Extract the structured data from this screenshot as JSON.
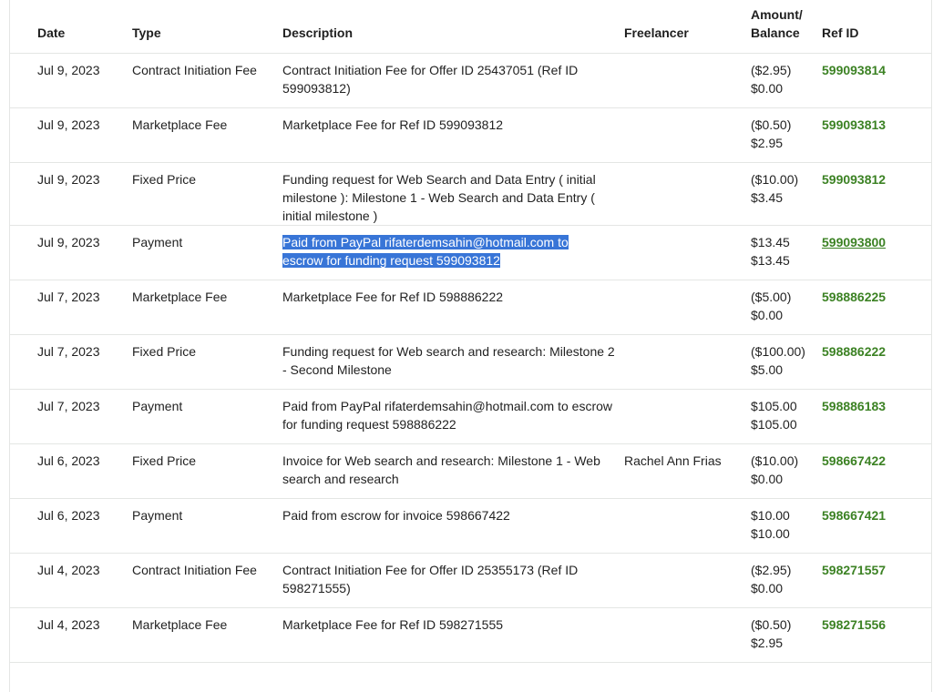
{
  "table": {
    "headers": {
      "date": "Date",
      "type": "Type",
      "description": "Description",
      "freelancer": "Freelancer",
      "amount_line1": "Amount/",
      "amount_line2": "Balance",
      "ref": "Ref ID"
    },
    "rows": [
      {
        "date": "Jul 9, 2023",
        "type": "Contract Initiation Fee",
        "description": "Contract Initiation Fee for Offer ID 25437051 (Ref ID 599093812)",
        "freelancer": "",
        "amount": "($2.95)",
        "balance": "$0.00",
        "ref": "599093814"
      },
      {
        "date": "Jul 9, 2023",
        "type": "Marketplace Fee",
        "description": "Marketplace Fee for Ref ID 599093812",
        "freelancer": "",
        "amount": "($0.50)",
        "balance": "$2.95",
        "ref": "599093813"
      },
      {
        "date": "Jul 9, 2023",
        "type": "Fixed Price",
        "description": "Funding request for Web Search and Data Entry ( initial milestone ): Milestone 1 - Web Search and Data Entry ( initial milestone )",
        "freelancer": "",
        "amount": "($10.00)",
        "balance": "$3.45",
        "ref": "599093812"
      },
      {
        "date": "Jul 9, 2023",
        "type": "Payment",
        "description_line1": "Paid from PayPal rifaterdemsahin@hotmail.com to",
        "description_line2": "escrow for funding request 599093812",
        "freelancer": "",
        "amount": "$13.45",
        "balance": "$13.45",
        "ref": "599093800"
      },
      {
        "date": "Jul 7, 2023",
        "type": "Marketplace Fee",
        "description": "Marketplace Fee for Ref ID 598886222",
        "freelancer": "",
        "amount": "($5.00)",
        "balance": "$0.00",
        "ref": "598886225"
      },
      {
        "date": "Jul 7, 2023",
        "type": "Fixed Price",
        "description": "Funding request for Web search and research: Milestone 2 - Second Milestone",
        "freelancer": "",
        "amount": "($100.00)",
        "balance": "$5.00",
        "ref": "598886222"
      },
      {
        "date": "Jul 7, 2023",
        "type": "Payment",
        "description": "Paid from PayPal rifaterdemsahin@hotmail.com to escrow for funding request 598886222",
        "freelancer": "",
        "amount": "$105.00",
        "balance": "$105.00",
        "ref": "598886183"
      },
      {
        "date": "Jul 6, 2023",
        "type": "Fixed Price",
        "description": "Invoice for Web search and research: Milestone 1 - Web search and research",
        "freelancer": "Rachel Ann Frias",
        "amount": "($10.00)",
        "balance": "$0.00",
        "ref": "598667422"
      },
      {
        "date": "Jul 6, 2023",
        "type": "Payment",
        "description": "Paid from escrow for invoice 598667422",
        "freelancer": "",
        "amount": "$10.00",
        "balance": "$10.00",
        "ref": "598667421"
      },
      {
        "date": "Jul 4, 2023",
        "type": "Contract Initiation Fee",
        "description": "Contract Initiation Fee for Offer ID 25355173 (Ref ID 598271555)",
        "freelancer": "",
        "amount": "($2.95)",
        "balance": "$0.00",
        "ref": "598271557"
      },
      {
        "date": "Jul 4, 2023",
        "type": "Marketplace Fee",
        "description": "Marketplace Fee for Ref ID 598271555",
        "freelancer": "",
        "amount": "($0.50)",
        "balance": "$2.95",
        "ref": "598271556"
      }
    ]
  },
  "colors": {
    "link": "#3c8224",
    "selection": "#3875d7",
    "border": "#e4e6e4"
  }
}
